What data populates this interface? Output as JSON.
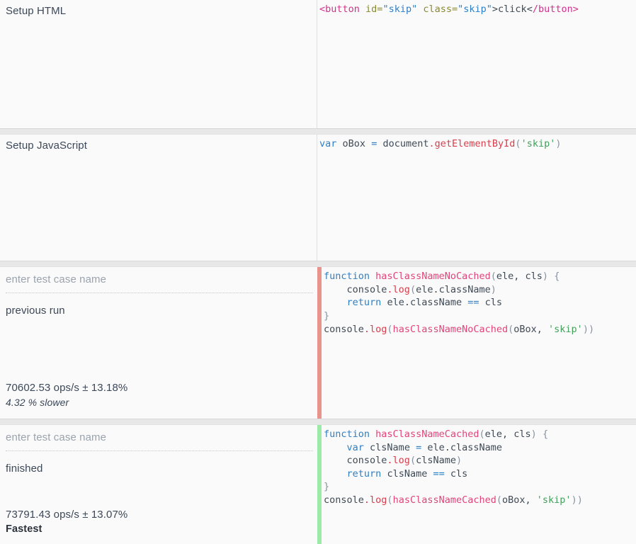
{
  "setup_sections": [
    {
      "label": "Setup HTML",
      "language": "html",
      "code_plain": "<button id=\"skip\" class=\"skip\">click</button>"
    },
    {
      "label": "Setup JavaScript",
      "language": "javascript",
      "code_plain": "var oBox = document.getElementById('skip')"
    }
  ],
  "test_cases": [
    {
      "name_value": "",
      "name_placeholder": "enter test case name",
      "status": "previous run",
      "ops": "70602.53 ops/s ± 13.18%",
      "verdict": "4.32 % slower",
      "verdict_type": "slower",
      "accent_color": "#e9938d",
      "code_plain": "function hasClassNameNoCached(ele, cls) {\n    console.log(ele.className)\n    return ele.className == cls\n}\nconsole.log(hasClassNameNoCached(oBox, 'skip'))"
    },
    {
      "name_value": "",
      "name_placeholder": "enter test case name",
      "status": "finished",
      "ops": "73791.43 ops/s ± 13.07%",
      "verdict": "Fastest",
      "verdict_type": "fastest",
      "accent_color": "#9ceaa8",
      "code_plain": "function hasClassNameCached(ele, cls) {\n    var clsName = ele.className\n    console.log(clsName)\n    return clsName == cls\n}\nconsole.log(hasClassNameCached(oBox, 'skip'))"
    }
  ],
  "theme": {
    "page_background": "#e8e8e8",
    "panel_background": "#fafafa",
    "text_color": "#3c4858",
    "placeholder_color": "#9aa3ad",
    "keyword_color": "#2f7fc5",
    "function_color": "#e0457b",
    "method_color": "#d83d4a",
    "string_color": "#42a05b",
    "tag_color": "#d0318c",
    "attribute_color": "#8a8a30"
  }
}
